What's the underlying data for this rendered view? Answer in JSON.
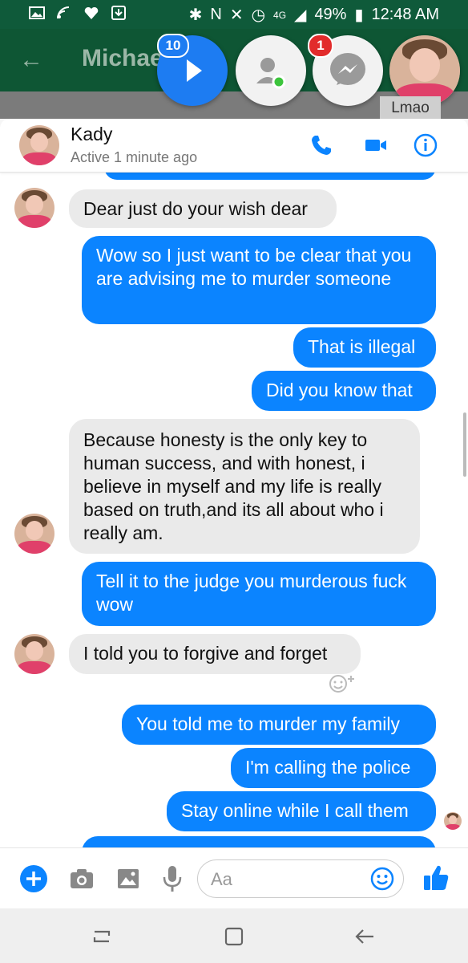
{
  "status_bar": {
    "battery": "49%",
    "time": "12:48 AM",
    "network": "4G"
  },
  "app_bar": {
    "title": "Michael..."
  },
  "chat_heads": {
    "messages_badge": "10",
    "messenger_badge": "1",
    "preview_label": "Lmao"
  },
  "header": {
    "name": "Kady",
    "status": "Active 1 minute ago"
  },
  "messages": [
    {
      "side": "in",
      "text": "Dear just do your wish dear"
    },
    {
      "side": "out",
      "text": "Wow so I just want to be clear that you are advising me to murder someone"
    },
    {
      "side": "out",
      "text": "That is illegal"
    },
    {
      "side": "out",
      "text": "Did you know that"
    },
    {
      "side": "in",
      "text": "Because honesty is the only key to human success, and with honest, i believe in myself and my life is really based on truth,and its all about who i really am."
    },
    {
      "side": "out",
      "text": "Tell it to the judge you murderous fuck wow"
    },
    {
      "side": "in",
      "text": "I told you to forgive and forget"
    },
    {
      "side": "out",
      "text": "You told me to murder my family"
    },
    {
      "side": "out",
      "text": "I'm calling the police"
    },
    {
      "side": "out",
      "text": "Stay online while I call them"
    }
  ],
  "composer": {
    "placeholder": "Aa"
  },
  "colors": {
    "accent": "#0b84ff",
    "appbar": "#0e5634",
    "incoming": "#eaeaea"
  },
  "icons": [
    "wifi-icon",
    "heart-icon",
    "phone-icon",
    "video-icon",
    "info-icon",
    "plus-icon",
    "camera-icon",
    "image-icon",
    "mic-icon",
    "emoji-icon",
    "thumbs-up-icon",
    "back-arrow-icon",
    "recent-apps-icon",
    "home-icon"
  ]
}
